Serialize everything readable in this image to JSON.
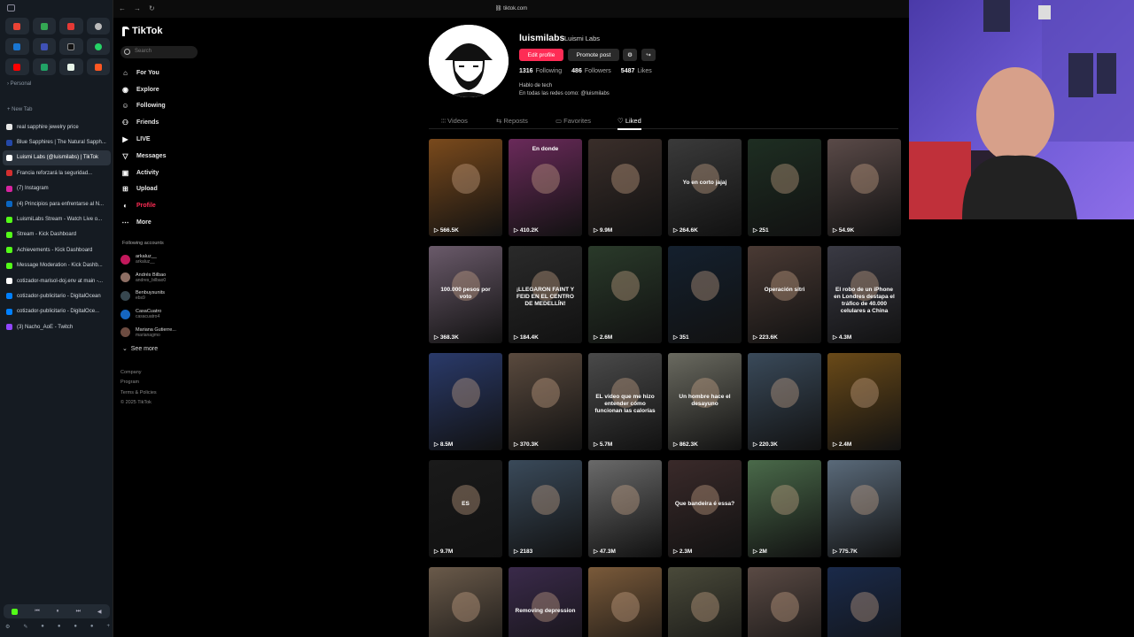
{
  "browser": {
    "space_label": "Personal",
    "new_tab_label": "New Tab",
    "tabs": [
      {
        "title": "real sapphire jewelry price",
        "color": "#e6e6e6",
        "active": false
      },
      {
        "title": "Blue Sapphires | The Natural Sapph...",
        "color": "#2448a8",
        "active": false
      },
      {
        "title": "Luismi Labs (@luismilabs) | TikTok",
        "color": "#ffffff",
        "active": true
      },
      {
        "title": "Francia reforzará la seguridad...",
        "color": "#d32f2f",
        "active": false
      },
      {
        "title": "(7) Instagram",
        "color": "#d6249f",
        "active": false
      },
      {
        "title": "(4) Principios para enfrentarse al N...",
        "color": "#0a66c2",
        "active": false
      },
      {
        "title": "LuismiLabs Stream - Watch Live o...",
        "color": "#53fc18",
        "active": false
      },
      {
        "title": "Stream - Kick Dashboard",
        "color": "#53fc18",
        "active": false
      },
      {
        "title": "Achievements - Kick Dashboard",
        "color": "#53fc18",
        "active": false
      },
      {
        "title": "Message Moderation - Kick Dashb...",
        "color": "#53fc18",
        "active": false
      },
      {
        "title": "cotizador-marisol-doj.env at main -...",
        "color": "#ffffff",
        "active": false
      },
      {
        "title": "cotizador-publicitario - DigitalOcean",
        "color": "#0080ff",
        "active": false
      },
      {
        "title": "cotizador-publicitario - DigitalOce...",
        "color": "#0080ff",
        "active": false
      },
      {
        "title": "(3) Nacho_AoE - Twitch",
        "color": "#9146ff",
        "active": false
      }
    ],
    "url": "tiktok.com"
  },
  "tiktok": {
    "logo": "TikTok",
    "search_placeholder": "Search",
    "nav": [
      {
        "label": "For You",
        "icon": "home-icon"
      },
      {
        "label": "Explore",
        "icon": "compass-icon"
      },
      {
        "label": "Following",
        "icon": "following-icon"
      },
      {
        "label": "Friends",
        "icon": "friends-icon"
      },
      {
        "label": "LIVE",
        "icon": "live-icon"
      },
      {
        "label": "Messages",
        "icon": "messages-icon"
      },
      {
        "label": "Activity",
        "icon": "activity-icon"
      },
      {
        "label": "Upload",
        "icon": "upload-icon"
      },
      {
        "label": "Profile",
        "icon": "profile-icon"
      },
      {
        "label": "More",
        "icon": "more-icon"
      }
    ],
    "following_title": "Following accounts",
    "accounts": [
      {
        "name": "arkaluz__",
        "handle": "arkaluz__"
      },
      {
        "name": "Andrés Bilbao",
        "handle": "andres_bilbao0"
      },
      {
        "name": "Benbuysunits",
        "handle": "ebs9"
      },
      {
        "name": "CasaCuatro",
        "handle": "casacuatro4"
      },
      {
        "name": "Mariana Gutierre...",
        "handle": "marianagmo"
      }
    ],
    "see_more": "See more",
    "footer": [
      "Company",
      "Program",
      "Terms & Policies",
      "© 2025 TikTok"
    ]
  },
  "profile": {
    "username": "luismilabs",
    "nickname": "Luismi Labs",
    "edit_button": "Edit profile",
    "promote_button": "Promote post",
    "following_count": "1316",
    "following_label": "Following",
    "followers_count": "486",
    "followers_label": "Followers",
    "likes_count": "5487",
    "likes_label": "Likes",
    "bio_line1": "Hablo de tech",
    "bio_line2": "En todas las redes como: @luismilabs",
    "tabs": [
      "Videos",
      "Reposts",
      "Favorites",
      "Liked"
    ],
    "active_tab": "Liked"
  },
  "videos": [
    {
      "views": "566.5K",
      "caption": "",
      "bg": "#7a4a1c"
    },
    {
      "views": "410.2K",
      "caption": "En donde",
      "bg": "#6a2a5a"
    },
    {
      "views": "9.9M",
      "caption": "",
      "bg": "#3a2e2a"
    },
    {
      "views": "264.6K",
      "caption": "Yo en corto jajaj",
      "bg": "#3a3a3a"
    },
    {
      "views": "251",
      "caption": "",
      "bg": "#1e2e22"
    },
    {
      "views": "54.9K",
      "caption": "",
      "bg": "#5a4a48"
    },
    {
      "views": "368.3K",
      "caption": "100.000 pesos por voto",
      "bg": "#6a5a6a"
    },
    {
      "views": "184.4K",
      "caption": "¡LLEGARON FAINT Y FEID EN EL CENTRO DE MEDELLÍN!",
      "bg": "#2a2a2a"
    },
    {
      "views": "2.6M",
      "caption": "",
      "bg": "#2a3a2a"
    },
    {
      "views": "351",
      "caption": "",
      "bg": "#14202e"
    },
    {
      "views": "223.6K",
      "caption": "Operación sitri",
      "bg": "#4a3a34"
    },
    {
      "views": "4.3M",
      "caption": "El robo de un iPhone en Londres destapa el tráfico de 40.000 celulares a China",
      "bg": "#3a3a44"
    },
    {
      "views": "8.5M",
      "caption": "",
      "bg": "#2a3a6a"
    },
    {
      "views": "370.3K",
      "caption": "",
      "bg": "#5a4a3e"
    },
    {
      "views": "5.7M",
      "caption": "EL video que me hizo entender cómo funcionan las calorías",
      "bg": "#4a4a4a"
    },
    {
      "views": "862.3K",
      "caption": "Un hombre hace el desayuno",
      "bg": "#6a6a60"
    },
    {
      "views": "220.3K",
      "caption": "",
      "bg": "#3a4a5a"
    },
    {
      "views": "2.4M",
      "caption": "",
      "bg": "#6a4a18"
    },
    {
      "views": "9.7M",
      "caption": "ES",
      "bg": "#1a1a1a"
    },
    {
      "views": "2183",
      "caption": "",
      "bg": "#3a4a5a"
    },
    {
      "views": "47.3M",
      "caption": "",
      "bg": "#6a6a6a"
    },
    {
      "views": "2.3M",
      "caption": "Que bandeira é essa?",
      "bg": "#3a2a2a"
    },
    {
      "views": "2M",
      "caption": "",
      "bg": "#4a6a4a"
    },
    {
      "views": "775.7K",
      "caption": "",
      "bg": "#5a6a7a"
    },
    {
      "views": "",
      "caption": "",
      "bg": "#6a5a4a"
    },
    {
      "views": "",
      "caption": "Removing depression",
      "bg": "#3a2a4a"
    },
    {
      "views": "",
      "caption": "",
      "bg": "#7a5a3a"
    },
    {
      "views": "",
      "caption": "",
      "bg": "#4a4a3a"
    },
    {
      "views": "",
      "caption": "",
      "bg": "#5a4a44"
    },
    {
      "views": "",
      "caption": "",
      "bg": "#1a2a4a"
    }
  ]
}
